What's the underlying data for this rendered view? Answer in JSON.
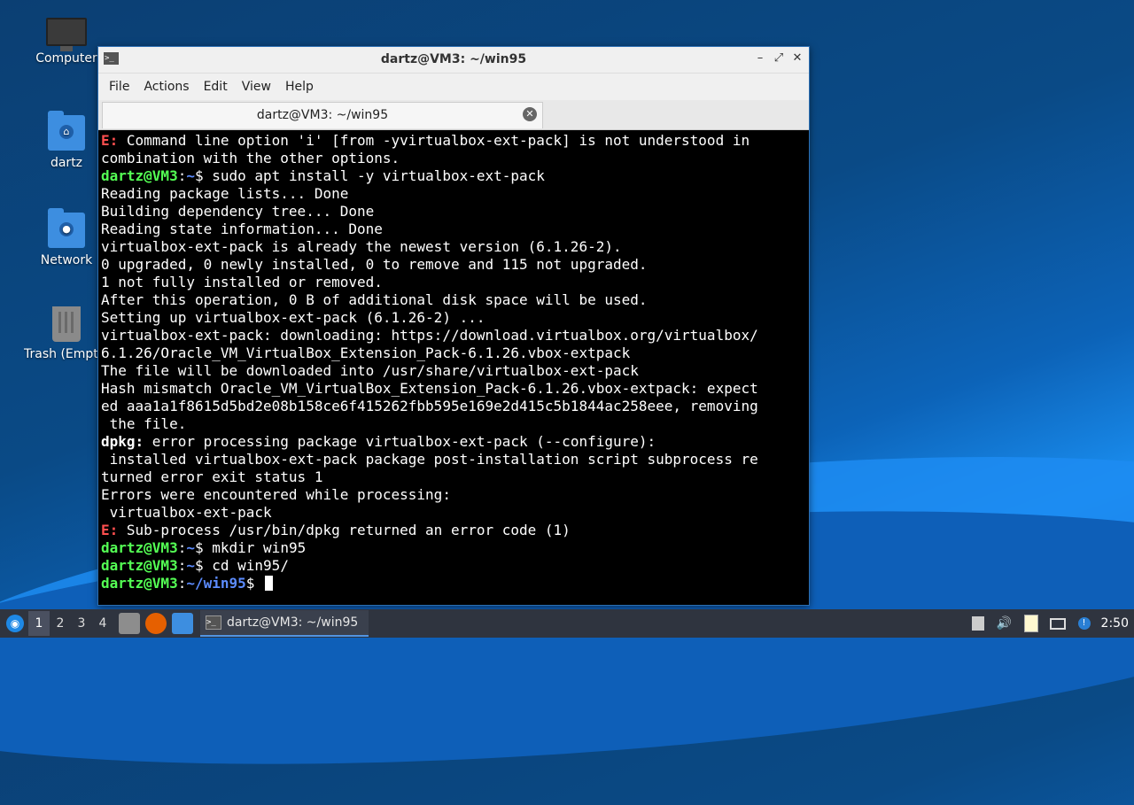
{
  "desktop": {
    "icons": [
      {
        "label": "Computer"
      },
      {
        "label": "dartz"
      },
      {
        "label": "Network"
      },
      {
        "label": "Trash (Empty)"
      }
    ]
  },
  "window": {
    "title": "dartz@VM3: ~/win95",
    "menu": [
      "File",
      "Actions",
      "Edit",
      "View",
      "Help"
    ],
    "tab_title": "dartz@VM3: ~/win95",
    "terminal": {
      "lines": [
        [
          {
            "t": "E:",
            "c": "e"
          },
          {
            "t": " Command line option 'i' [from -yvirtualbox-ext-pack] is not understood in"
          }
        ],
        [
          {
            "t": "combination with the other options."
          }
        ],
        [
          {
            "t": "dartz@VM3",
            "c": "u"
          },
          {
            "t": ":",
            "c": ""
          },
          {
            "t": "~",
            "c": "p"
          },
          {
            "t": "$ sudo apt install -y virtualbox-ext-pack"
          }
        ],
        [
          {
            "t": "Reading package lists... Done"
          }
        ],
        [
          {
            "t": "Building dependency tree... Done"
          }
        ],
        [
          {
            "t": "Reading state information... Done"
          }
        ],
        [
          {
            "t": "virtualbox-ext-pack is already the newest version (6.1.26-2)."
          }
        ],
        [
          {
            "t": "0 upgraded, 0 newly installed, 0 to remove and 115 not upgraded."
          }
        ],
        [
          {
            "t": "1 not fully installed or removed."
          }
        ],
        [
          {
            "t": "After this operation, 0 B of additional disk space will be used."
          }
        ],
        [
          {
            "t": "Setting up virtualbox-ext-pack (6.1.26-2) ..."
          }
        ],
        [
          {
            "t": "virtualbox-ext-pack: downloading: https://download.virtualbox.org/virtualbox/"
          }
        ],
        [
          {
            "t": "6.1.26/Oracle_VM_VirtualBox_Extension_Pack-6.1.26.vbox-extpack"
          }
        ],
        [
          {
            "t": "The file will be downloaded into /usr/share/virtualbox-ext-pack"
          }
        ],
        [
          {
            "t": "Hash mismatch Oracle_VM_VirtualBox_Extension_Pack-6.1.26.vbox-extpack: expect"
          }
        ],
        [
          {
            "t": "ed aaa1a1f8615d5bd2e08b158ce6f415262fbb595e169e2d415c5b1844ac258eee, removing"
          }
        ],
        [
          {
            "t": " the file."
          }
        ],
        [
          {
            "t": "dpkg:",
            "c": "b"
          },
          {
            "t": " error processing package virtualbox-ext-pack (--configure):"
          }
        ],
        [
          {
            "t": " installed virtualbox-ext-pack package post-installation script subprocess re"
          }
        ],
        [
          {
            "t": "turned error exit status 1"
          }
        ],
        [
          {
            "t": "Errors were encountered while processing:"
          }
        ],
        [
          {
            "t": " virtualbox-ext-pack"
          }
        ],
        [
          {
            "t": "E:",
            "c": "e"
          },
          {
            "t": " Sub-process /usr/bin/dpkg returned an error code (1)"
          }
        ],
        [
          {
            "t": "dartz@VM3",
            "c": "u"
          },
          {
            "t": ":"
          },
          {
            "t": "~",
            "c": "p"
          },
          {
            "t": "$ mkdir win95"
          }
        ],
        [
          {
            "t": "dartz@VM3",
            "c": "u"
          },
          {
            "t": ":"
          },
          {
            "t": "~",
            "c": "p"
          },
          {
            "t": "$ cd win95/"
          }
        ],
        [
          {
            "t": "dartz@VM3",
            "c": "u"
          },
          {
            "t": ":"
          },
          {
            "t": "~/win95",
            "c": "p"
          },
          {
            "t": "$ "
          }
        ]
      ]
    }
  },
  "taskbar": {
    "workspaces": [
      "1",
      "2",
      "3",
      "4"
    ],
    "active_workspace": "1",
    "task_label": "dartz@VM3: ~/win95",
    "clock": "2:50"
  },
  "icons": {
    "start": "start-menu-icon",
    "file_manager": "file-manager-icon",
    "browser": "firefox-icon",
    "desktop": "show-desktop-icon",
    "tray": [
      "notification-icon",
      "volume-icon",
      "clipboard-icon",
      "network-icon",
      "update-icon"
    ]
  }
}
